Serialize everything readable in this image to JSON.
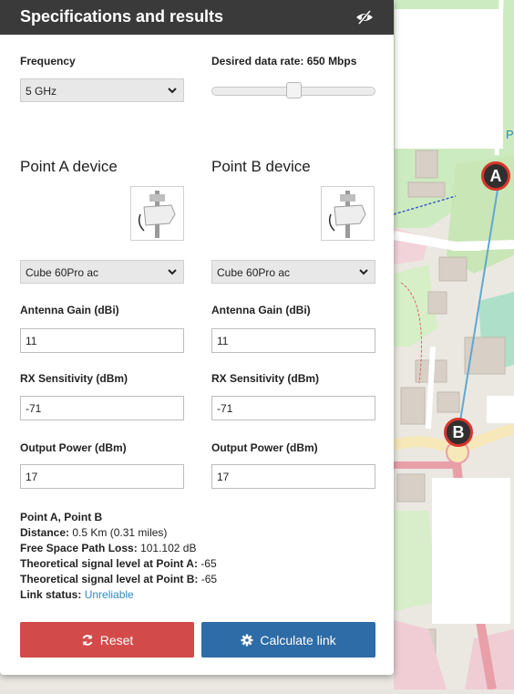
{
  "panel": {
    "title": "Specifications and results"
  },
  "frequency": {
    "label": "Frequency",
    "selected": "5 GHz"
  },
  "data_rate": {
    "label": "Desired data rate: 650 Mbps",
    "slider_fraction": 0.5
  },
  "point_a": {
    "heading": "Point A device",
    "device": "Cube 60Pro ac",
    "antenna_gain_label": "Antenna Gain (dBi)",
    "antenna_gain": "11",
    "rx_label": "RX Sensitivity (dBm)",
    "rx": "-71",
    "power_label": "Output Power (dBm)",
    "power": "17"
  },
  "point_b": {
    "heading": "Point B device",
    "device": "Cube 60Pro ac",
    "antenna_gain_label": "Antenna Gain (dBi)",
    "antenna_gain": "11",
    "rx_label": "RX Sensitivity (dBm)",
    "rx": "-71",
    "power_label": "Output Power (dBm)",
    "power": "17"
  },
  "results": {
    "title": "Point A, Point B",
    "distance_label": "Distance:",
    "distance_value": "0.5 Km (0.31 miles)",
    "fspl_label": "Free Space Path Loss:",
    "fspl_value": "101.102 dB",
    "sig_a_label": "Theoretical signal level at Point A:",
    "sig_a_value": "-65",
    "sig_b_label": "Theoretical signal level at Point B:",
    "sig_b_value": "-65",
    "status_label": "Link status:",
    "status_value": "Unreliable"
  },
  "buttons": {
    "reset": "Reset",
    "calculate": "Calculate link"
  },
  "map": {
    "marker_a": "A",
    "marker_b": "B",
    "corner_letter": "P",
    "link_color": "#5fa8d3",
    "marker_ring_color": "#d9342b"
  }
}
